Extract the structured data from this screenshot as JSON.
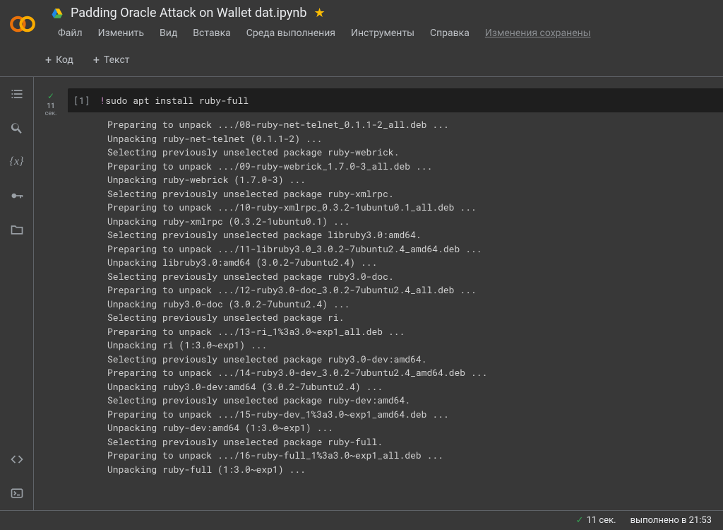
{
  "header": {
    "title": "Padding Oracle Attack on Wallet dat.ipynb"
  },
  "menu": {
    "file": "Файл",
    "edit": "Изменить",
    "view": "Вид",
    "insert": "Вставка",
    "runtime": "Среда выполнения",
    "tools": "Инструменты",
    "help": "Справка",
    "save_status": "Изменения сохранены"
  },
  "toolbar": {
    "code": "Код",
    "text": "Текст"
  },
  "cell": {
    "number": "[1]",
    "exec_time": "11",
    "exec_unit": "сек.",
    "code_bang": "!",
    "code_rest": "sudo apt install ruby-full",
    "output": "Preparing to unpack .../08-ruby-net-telnet_0.1.1-2_all.deb ...\nUnpacking ruby-net-telnet (0.1.1-2) ...\nSelecting previously unselected package ruby-webrick.\nPreparing to unpack .../09-ruby-webrick_1.7.0-3_all.deb ...\nUnpacking ruby-webrick (1.7.0-3) ...\nSelecting previously unselected package ruby-xmlrpc.\nPreparing to unpack .../10-ruby-xmlrpc_0.3.2-1ubuntu0.1_all.deb ...\nUnpacking ruby-xmlrpc (0.3.2-1ubuntu0.1) ...\nSelecting previously unselected package libruby3.0:amd64.\nPreparing to unpack .../11-libruby3.0_3.0.2-7ubuntu2.4_amd64.deb ...\nUnpacking libruby3.0:amd64 (3.0.2-7ubuntu2.4) ...\nSelecting previously unselected package ruby3.0-doc.\nPreparing to unpack .../12-ruby3.0-doc_3.0.2-7ubuntu2.4_all.deb ...\nUnpacking ruby3.0-doc (3.0.2-7ubuntu2.4) ...\nSelecting previously unselected package ri.\nPreparing to unpack .../13-ri_1%3a3.0~exp1_all.deb ...\nUnpacking ri (1:3.0~exp1) ...\nSelecting previously unselected package ruby3.0-dev:amd64.\nPreparing to unpack .../14-ruby3.0-dev_3.0.2-7ubuntu2.4_amd64.deb ...\nUnpacking ruby3.0-dev:amd64 (3.0.2-7ubuntu2.4) ...\nSelecting previously unselected package ruby-dev:amd64.\nPreparing to unpack .../15-ruby-dev_1%3a3.0~exp1_amd64.deb ...\nUnpacking ruby-dev:amd64 (1:3.0~exp1) ...\nSelecting previously unselected package ruby-full.\nPreparing to unpack .../16-ruby-full_1%3a3.0~exp1_all.deb ...\nUnpacking ruby-full (1:3.0~exp1) ..."
  },
  "status": {
    "time": "11 сек.",
    "completed": "выполнено в 21:53"
  }
}
